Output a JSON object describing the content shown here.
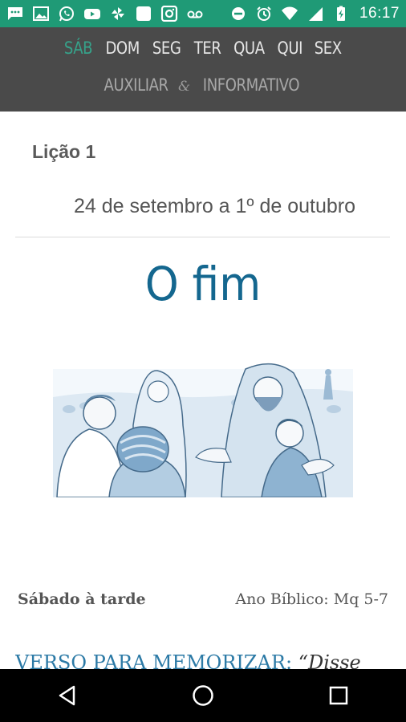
{
  "status_bar": {
    "time": "16:17",
    "left_icons": [
      "messages-icon",
      "gallery-icon",
      "whatsapp-icon",
      "youtube-icon",
      "pinwheel-icon",
      "blank-app-icon",
      "instagram-icon",
      "voicemail-icon"
    ],
    "right_icons": [
      "do-not-disturb-icon",
      "alarm-icon",
      "wifi-icon",
      "signal-icon",
      "battery-charging-icon"
    ],
    "background": "#1f9a76"
  },
  "nav": {
    "days": [
      "SÁB",
      "DOM",
      "SEG",
      "TER",
      "QUA",
      "QUI",
      "SEX"
    ],
    "active_index": 0,
    "extra_left": "AUXILIAR",
    "extra_amp": "&",
    "extra_right": "INFORMATIVO",
    "active_color": "#36a28a",
    "background": "#4a4a4a"
  },
  "lesson": {
    "label": "Lição 1",
    "date_range": "24 de setembro a 1º de outubro",
    "title": "O fim",
    "title_color": "#14678f",
    "illustration": "jesus-teaching-disciples-illustration"
  },
  "meta": {
    "day_label": "Sábado à tarde",
    "bible_year": "Ano Bíblico: Mq 5-7"
  },
  "memory_verse": {
    "label": "VERSO PARA MEMORIZAR:",
    "text_start": "“Disse"
  },
  "nav_bar": {
    "buttons": [
      "back-icon",
      "home-icon",
      "recents-icon"
    ]
  }
}
